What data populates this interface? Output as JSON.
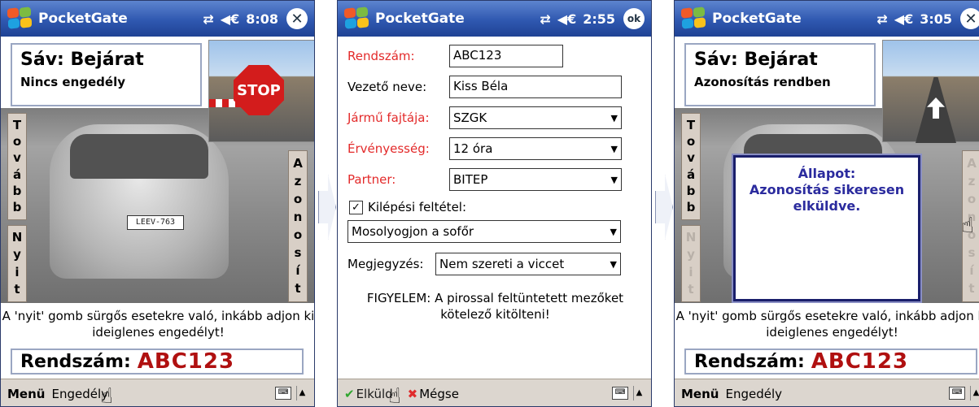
{
  "screen1": {
    "title": "PocketGate",
    "time": "8:08",
    "close_symbol": "✕",
    "lane_title": "Sáv: Bejárat",
    "lane_status": "Nincs engedély",
    "stop_text": "STOP",
    "license_on_car": "LEEV-763",
    "left_buttons": [
      [
        "T",
        "o",
        "v",
        "á",
        "b",
        "b"
      ],
      [
        "N",
        "y",
        "i",
        "t"
      ]
    ],
    "right_button": [
      "A",
      "z",
      "o",
      "n",
      "o",
      "s",
      "í",
      "t"
    ],
    "notice": "A 'nyit' gomb sürgős esetekre való, inkább adjon ki ideiglenes engedélyt!",
    "plate_label": "Rendszám:",
    "plate_value": "ABC123",
    "menu_left": "Menü",
    "menu_right": "Engedély"
  },
  "screen2": {
    "title": "PocketGate",
    "time": "2:55",
    "ok_label": "ok",
    "fields": [
      {
        "label": "Rendszám:",
        "value": "ABC123",
        "required": true,
        "type": "text"
      },
      {
        "label": "Vezető neve:",
        "value": "Kiss Béla",
        "required": false,
        "type": "text"
      },
      {
        "label": "Jármű fajtája:",
        "value": "SZGK",
        "required": true,
        "type": "select"
      },
      {
        "label": "Érvényesség:",
        "value": "12 óra",
        "required": true,
        "type": "select"
      },
      {
        "label": "Partner:",
        "value": "BITEP",
        "required": true,
        "type": "select"
      }
    ],
    "exit_condition_label": "Kilépési feltétel:",
    "exit_condition_checked": true,
    "exit_condition_value": "Mosolyogjon a sofőr",
    "note_label": "Megjegyzés:",
    "note_value": "Nem szereti a viccet",
    "warning": "FIGYELEM: A pirossal feltüntetett mezőket kötelező kitölteni!",
    "send_label": "Elküld",
    "cancel_label": "Mégse"
  },
  "screen3": {
    "title": "PocketGate",
    "time": "3:05",
    "close_symbol": "✕",
    "lane_title": "Sáv: Bejárat",
    "lane_status": "Azonosítás rendben",
    "dialog_title": "Állapot:",
    "dialog_message": "Azonosítás sikeresen elküldve.",
    "left_buttons": [
      [
        "T",
        "o",
        "v",
        "á",
        "b",
        "b"
      ],
      [
        "N",
        "y",
        "i",
        "t"
      ]
    ],
    "right_button": [
      "A",
      "z",
      "o",
      "n",
      "o",
      "s",
      "í",
      "t"
    ],
    "notice": "A 'nyit' gomb sürgős esetekre való, inkább adjon ki ideiglenes engedélyt!",
    "plate_label": "Rendszám:",
    "plate_value": "ABC123",
    "menu_left": "Menü",
    "menu_right": "Engedély"
  },
  "colors": {
    "title_bar": "#2f58b0",
    "required_label": "#e32a2a",
    "plate_value": "#b01010",
    "dialog_text": "#2b2b9e"
  }
}
